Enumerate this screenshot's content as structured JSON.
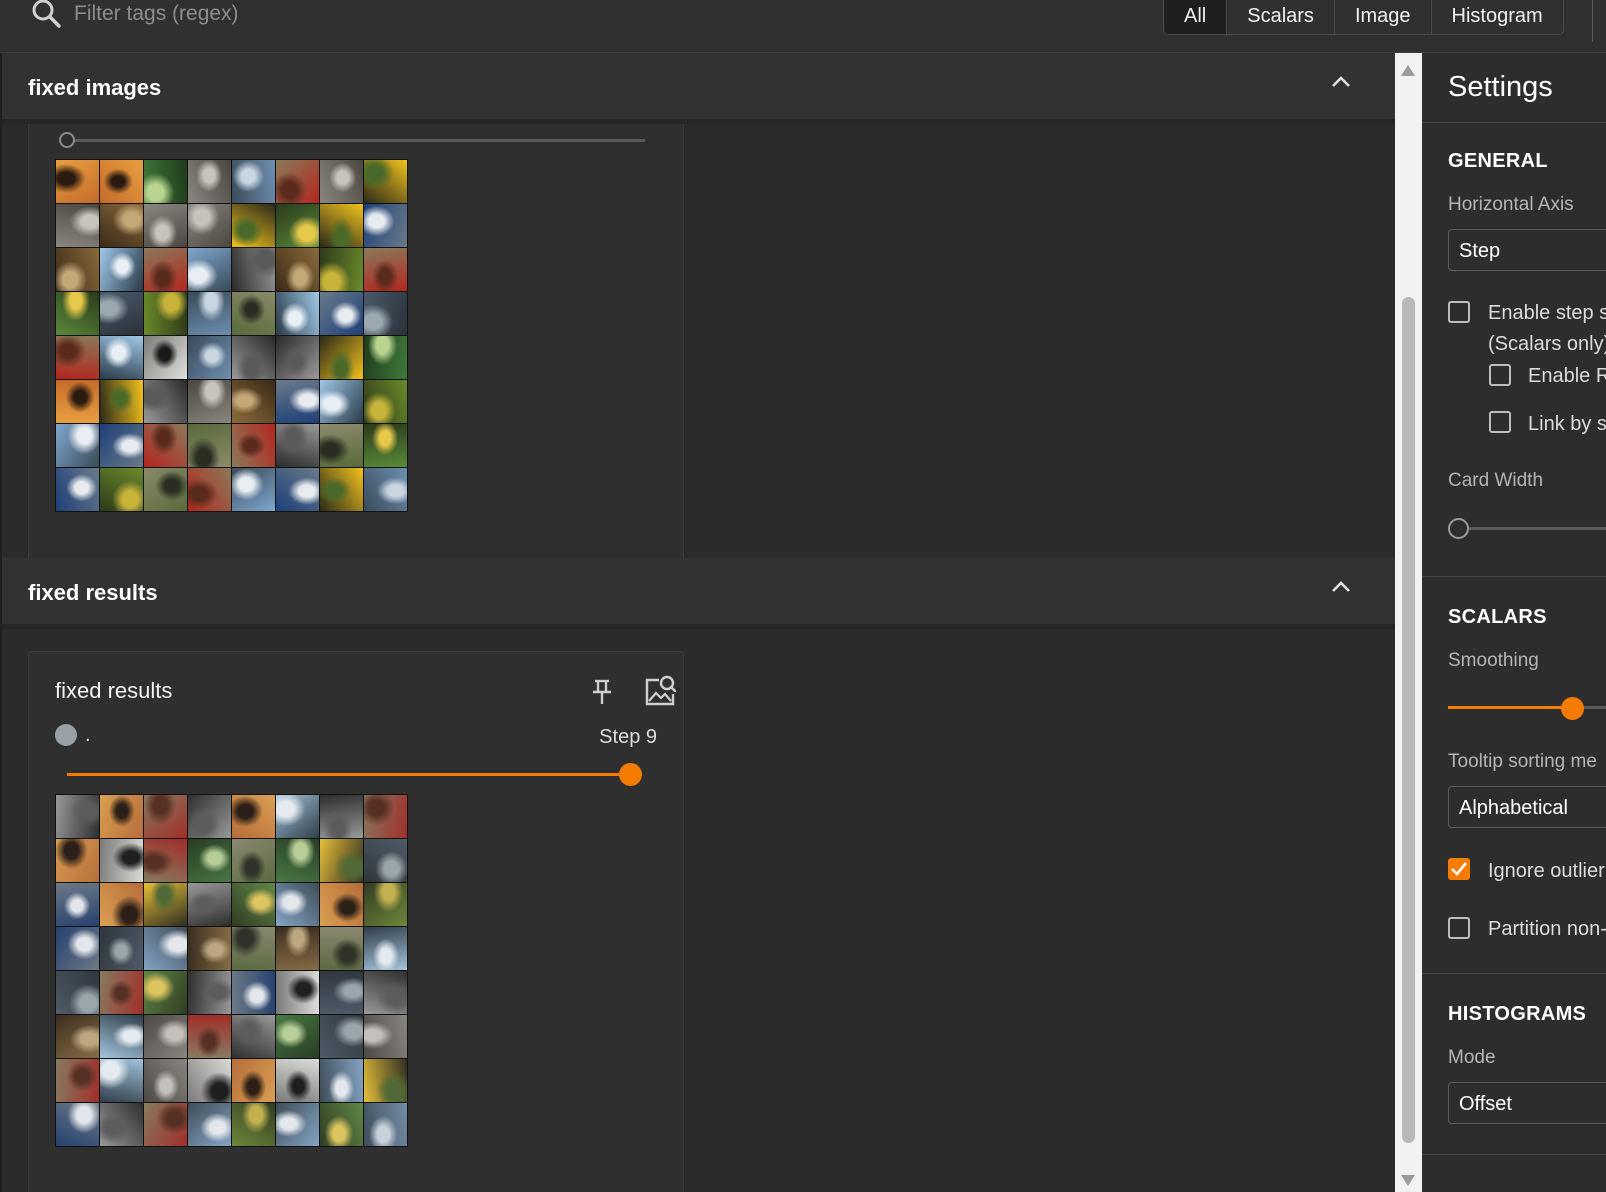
{
  "search": {
    "placeholder": "Filter tags (regex)"
  },
  "tabs": [
    {
      "label": "All",
      "active": true
    },
    {
      "label": "Scalars",
      "active": false
    },
    {
      "label": "Image",
      "active": false
    },
    {
      "label": "Histogram",
      "active": false
    }
  ],
  "groups": {
    "fixed_images": {
      "title": "fixed images"
    },
    "fixed_results": {
      "title": "fixed results",
      "card": {
        "title": "fixed results",
        "run_name": ".",
        "step_label": "Step 9",
        "step_position": 1.0
      }
    }
  },
  "settings": {
    "title": "Settings",
    "general": {
      "heading": "GENERAL",
      "horizontal_axis_label": "Horizontal Axis",
      "horizontal_axis_value": "Step",
      "enable_step_selection_line1": "Enable step s",
      "enable_step_selection_line2": "(Scalars only)",
      "enable_range_label": "Enable R",
      "link_by_step_label": "Link by s",
      "card_width_label": "Card Width",
      "card_width_level": 0
    },
    "scalars": {
      "heading": "SCALARS",
      "smoothing_label": "Smoothing",
      "smoothing_level": 0.6,
      "tooltip_sorting_label": "Tooltip sorting me",
      "tooltip_sorting_value": "Alphabetical",
      "ignore_outliers_label": "Ignore outlier",
      "ignore_outliers_checked": true,
      "partition_label": "Partition non-"
    },
    "histograms": {
      "heading": "HISTOGRAMS",
      "mode_label": "Mode",
      "mode_value": "Offset"
    }
  },
  "colors": {
    "accent": "#f57c00",
    "background": "#2b2b2b",
    "header": "#323232",
    "run_color": "#9aa0a6"
  }
}
